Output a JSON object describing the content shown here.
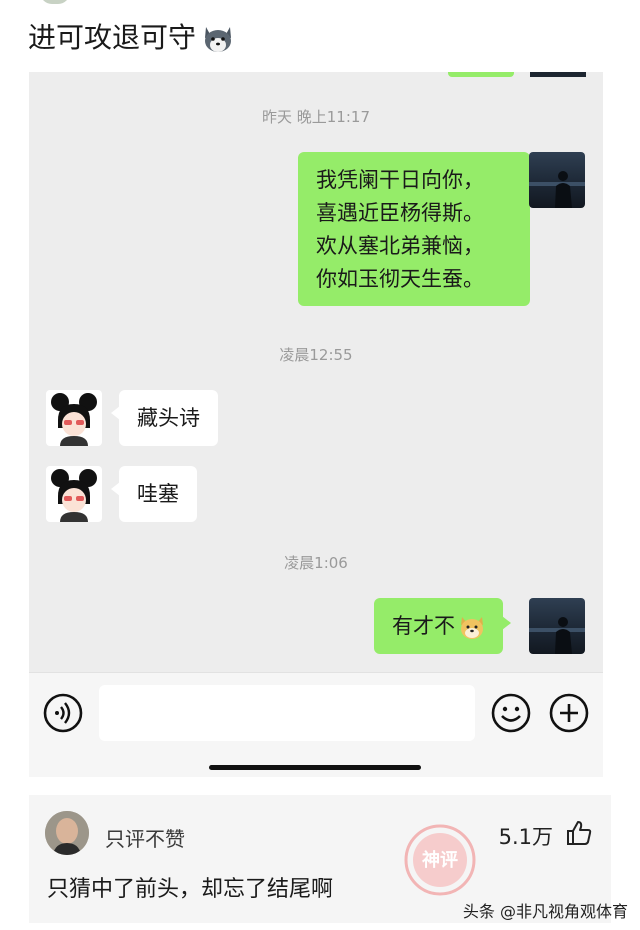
{
  "post": {
    "title": "进可攻退可守"
  },
  "chat": {
    "timestamps": [
      "昨天 晚上11:17",
      "凌晨12:55",
      "凌晨1:06"
    ],
    "messages": [
      {
        "side": "right",
        "lines": [
          "我凭阑干日向你，",
          "喜遇近臣杨得斯。",
          "欢从塞北弟兼恼，",
          "你如玉彻天生蚕。"
        ]
      },
      {
        "side": "left",
        "text": "藏头诗"
      },
      {
        "side": "left",
        "text": "哇塞"
      },
      {
        "side": "right",
        "text": "有才不",
        "emoji": "doge-emoji"
      }
    ]
  },
  "comment": {
    "username": "只评不赞",
    "likes": "5.1万",
    "text": "只猜中了前头，却忘了结尾啊",
    "stamp_text": "神评"
  },
  "watermark": "头条 @非凡视角观体育",
  "colors": {
    "sent_bubble": "#95ec69",
    "received_bubble": "#ffffff",
    "chat_bg": "#ededed"
  }
}
